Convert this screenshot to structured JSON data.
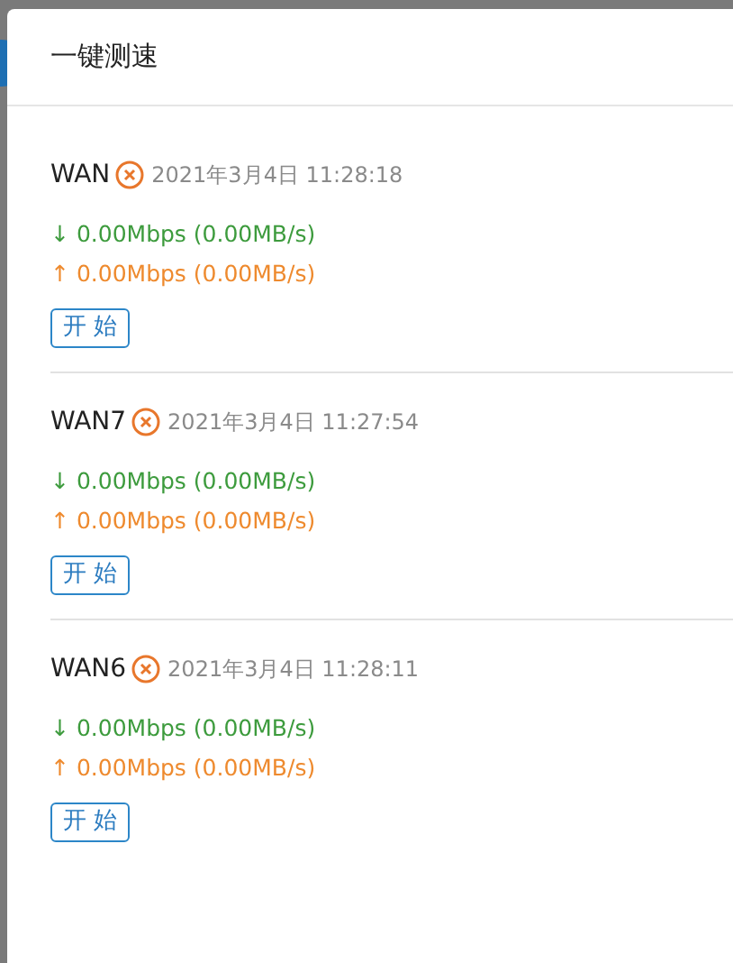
{
  "dialog": {
    "title": "一键测速"
  },
  "lines": [
    {
      "name": "WAN",
      "failed": true,
      "time": "2021年3月4日 11:28:18",
      "download": "↓ 0.00Mbps (0.00MB/s)",
      "upload": "↑ 0.00Mbps (0.00MB/s)",
      "button": "开 始"
    },
    {
      "name": "WAN7",
      "failed": true,
      "time": "2021年3月4日 11:27:54",
      "download": "↓ 0.00Mbps (0.00MB/s)",
      "upload": "↑ 0.00Mbps (0.00MB/s)",
      "button": "开 始"
    },
    {
      "name": "WAN6",
      "failed": true,
      "time": "2021年3月4日 11:28:11",
      "download": "↓ 0.00Mbps (0.00MB/s)",
      "upload": "↑ 0.00Mbps (0.00MB/s)",
      "button": "开 始"
    }
  ]
}
